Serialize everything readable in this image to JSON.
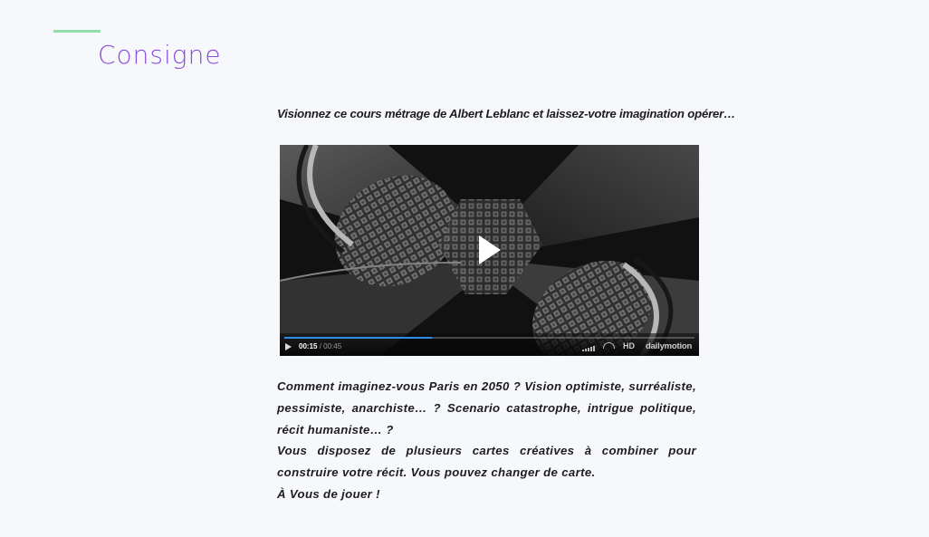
{
  "section": {
    "title": "Consigne"
  },
  "intro_text": "Visionnez ce cours métrage de Albert Leblanc et laissez-votre imagination opérer…",
  "video": {
    "current_time": "00:15",
    "separator": " / ",
    "total_time": "00:45",
    "progress": 0.36,
    "quality_label": "HD",
    "brand": "dailymotion",
    "accent_color": "#2f8de8"
  },
  "body_paragraphs": [
    "Comment imaginez-vous Paris en 2050 ? Vision optimiste, surréaliste, pessimiste, anarchiste… ? Scenario catastrophe, intrigue politique, récit humaniste… ?",
    "Vous disposez de plusieurs cartes créatives à combiner pour construire votre récit. Vous pouvez changer de carte.",
    "À Vous de jouer !"
  ],
  "colors": {
    "title": "#8a4fd6",
    "accent_line": "#8fe0a8",
    "background": "#f7f8fb"
  }
}
